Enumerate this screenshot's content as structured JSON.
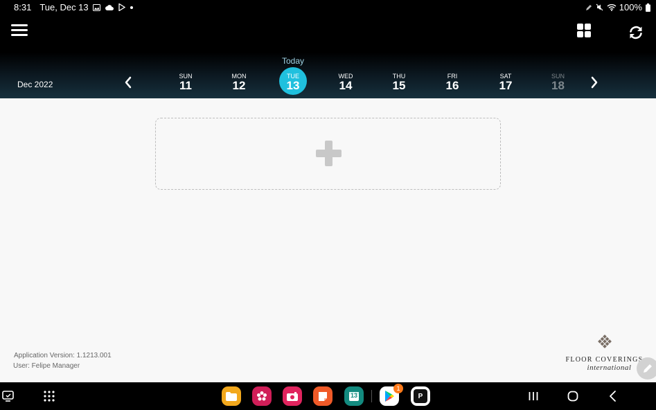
{
  "status_bar": {
    "time": "8:31",
    "date": "Tue, Dec 13",
    "battery": "100%"
  },
  "header": {
    "month": "Dec 2022",
    "today_label": "Today",
    "days": [
      {
        "name": "SUN",
        "num": "11"
      },
      {
        "name": "MON",
        "num": "12"
      },
      {
        "name": "TUE",
        "num": "13",
        "selected": true
      },
      {
        "name": "WED",
        "num": "14"
      },
      {
        "name": "THU",
        "num": "15"
      },
      {
        "name": "FRI",
        "num": "16"
      },
      {
        "name": "SAT",
        "num": "17"
      },
      {
        "name": "SUN",
        "num": "18",
        "partial": true
      }
    ]
  },
  "footer": {
    "version": "Application Version: 1.1213.001",
    "user": "User: Felipe Manager"
  },
  "logo": {
    "name": "FLOOR COVERINGS",
    "sub": "international"
  },
  "taskbar": {
    "play_badge": "1",
    "calendar_date": "13",
    "pinned_app_letter": "P"
  },
  "colors": {
    "accent": "#20c0de",
    "header_bg": "#000000",
    "background": "#f8f8f8"
  },
  "icons": [
    "menu-icon",
    "grid-icon",
    "refresh-icon",
    "chevron-left-icon",
    "chevron-right-icon",
    "plus-icon",
    "pencil-icon"
  ]
}
